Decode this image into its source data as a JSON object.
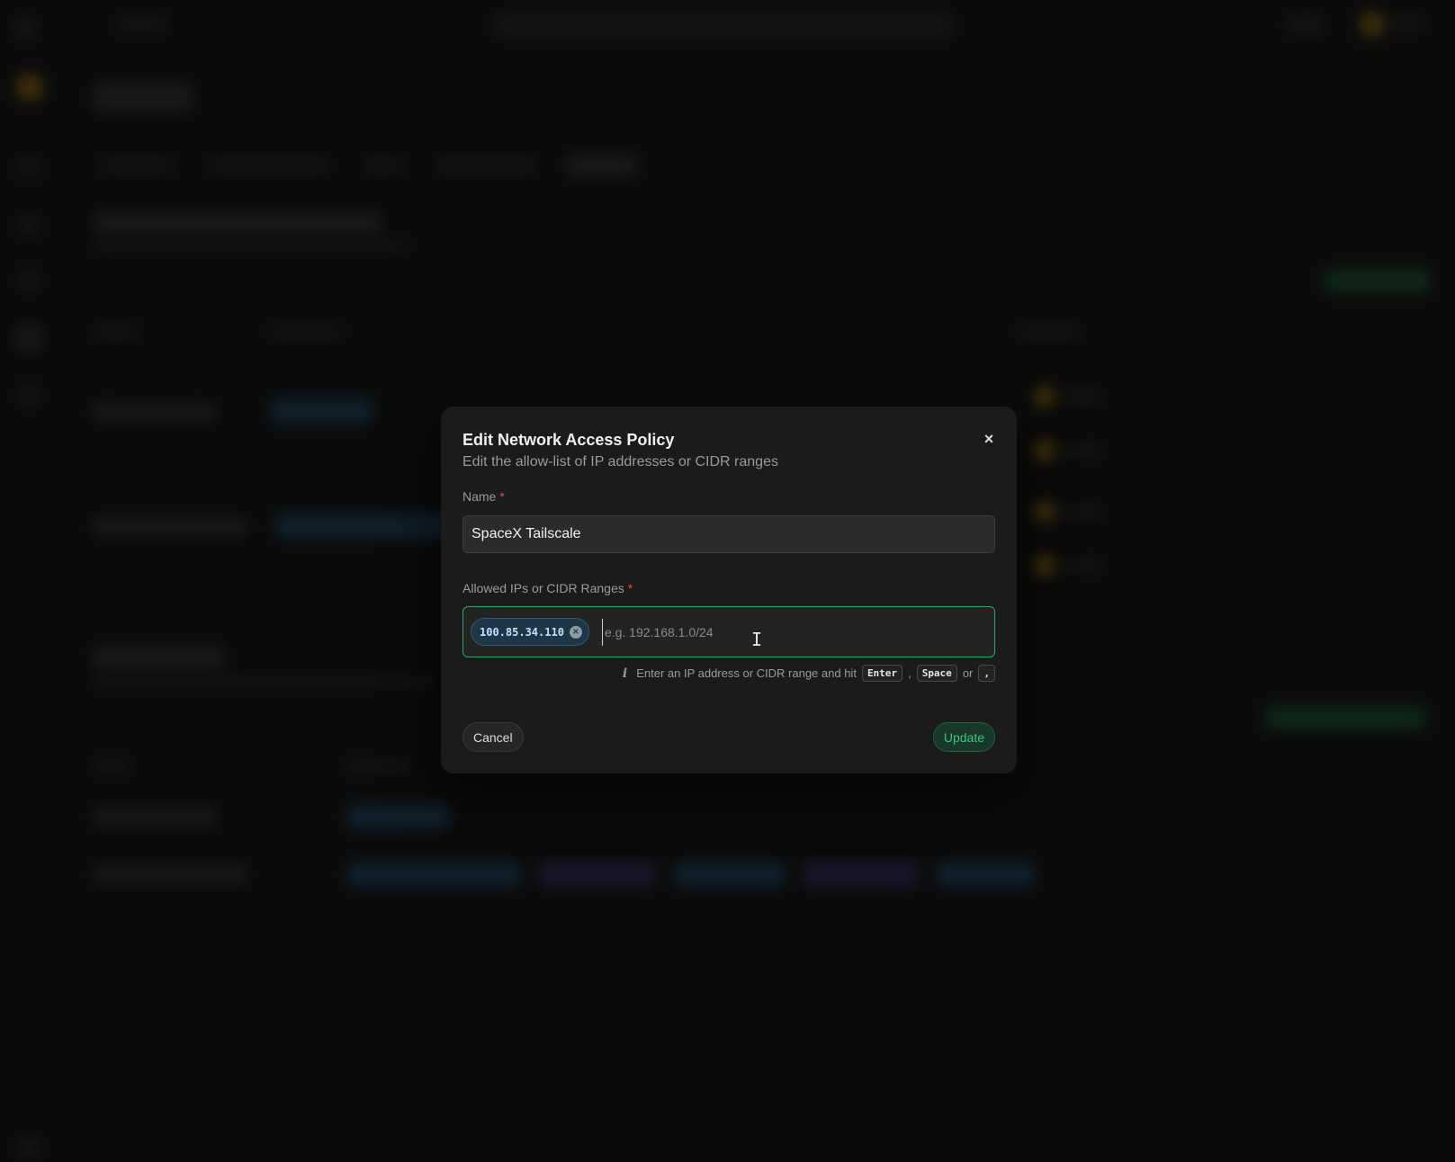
{
  "modal": {
    "title": "Edit Network Access Policy",
    "subtitle": "Edit the allow-list of IP addresses or CIDR ranges",
    "close_icon": "×",
    "name_field": {
      "label": "Name",
      "required_mark": "*",
      "value": "SpaceX Tailscale"
    },
    "cidr_field": {
      "label": "Allowed IPs or CIDR Ranges",
      "required_mark": "*",
      "chips": [
        "100.85.34.110"
      ],
      "chip_remove_icon": "×",
      "placeholder": "e.g. 192.168.1.0/24"
    },
    "hint": {
      "icon": "i",
      "text": "Enter an IP address or CIDR range and hit",
      "key1": "Enter",
      "sep1": ",",
      "key2": "Space",
      "sep2": "or",
      "key3": ","
    },
    "cancel_label": "Cancel",
    "update_label": "Update"
  },
  "colors": {
    "accent_green": "#3fc27d",
    "focus_border": "#2ea46a",
    "required_red": "#e5484d",
    "chip_bg": "#1f3646"
  }
}
